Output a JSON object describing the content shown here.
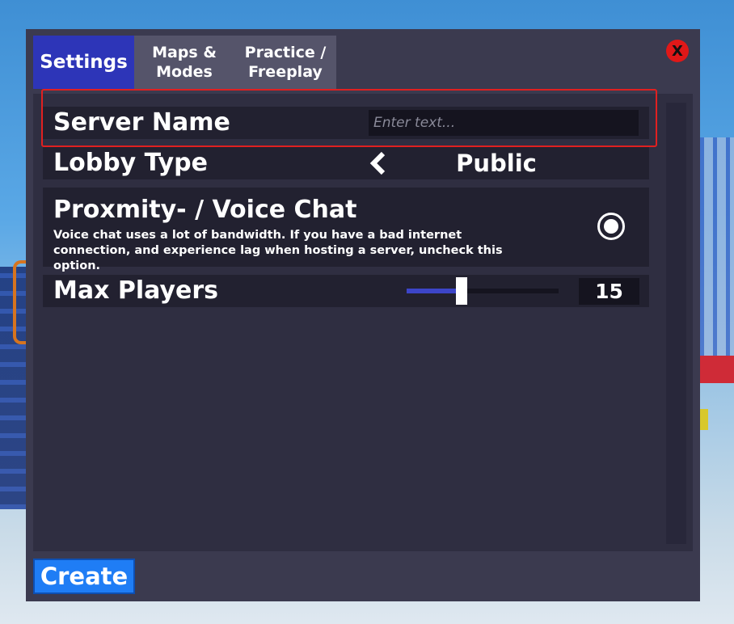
{
  "tabs": [
    {
      "label": "Settings",
      "active": true
    },
    {
      "label": "Maps &\nModes",
      "active": false
    },
    {
      "label": "Practice /\nFreeplay",
      "active": false
    }
  ],
  "close_button": {
    "label": "X",
    "color": "#e01818"
  },
  "settings": {
    "server_name": {
      "label": "Server Name",
      "placeholder": "Enter text...",
      "value": ""
    },
    "lobby_type": {
      "label": "Lobby Type",
      "value": "Public",
      "icon": "chevron-left-icon"
    },
    "voice_chat": {
      "label": "Proxmity- / Voice Chat",
      "description": "Voice chat uses a lot of bandwidth. If you have a bad internet connection, and experience lag when hosting a server, uncheck this option.",
      "checked": true
    },
    "max_players": {
      "label": "Max Players",
      "value": "15",
      "slider_fraction": 0.36
    }
  },
  "create_button": {
    "label": "Create"
  },
  "colors": {
    "accent": "#2d35b8",
    "create": "#1f7df5",
    "highlight": "#e02020",
    "panel": "#2f2e41",
    "row": "#222130"
  }
}
